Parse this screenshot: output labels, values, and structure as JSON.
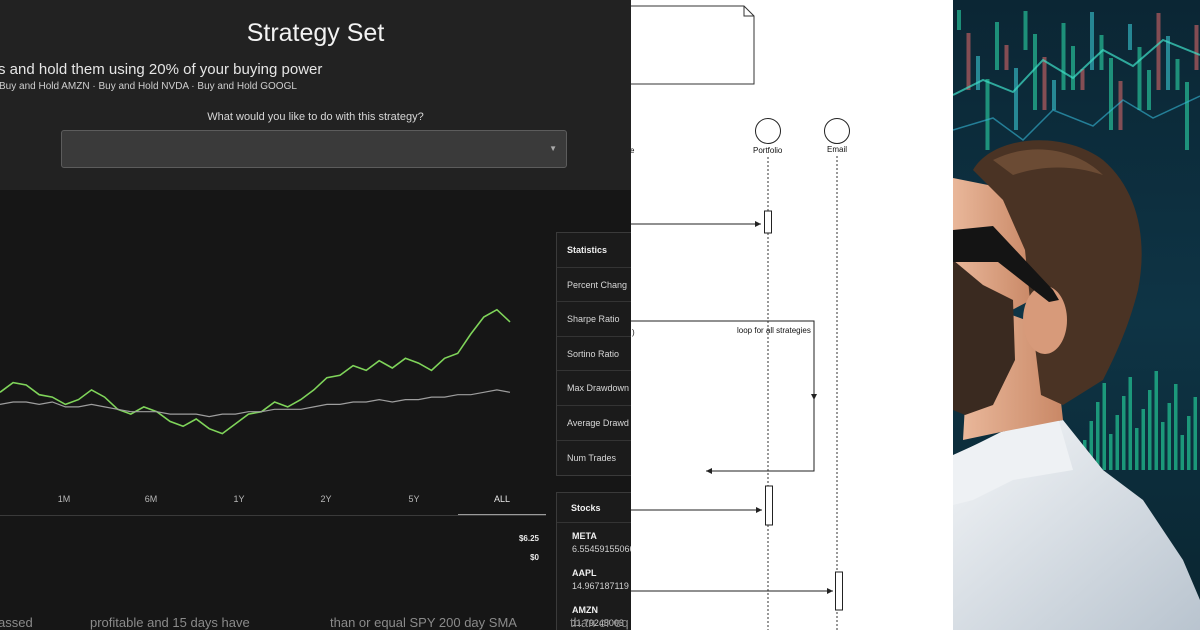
{
  "strategy": {
    "title": "Strategy Set",
    "subtitle": "s and hold them using 20% of your buying power",
    "components": "Buy and Hold AMZN · Buy and Hold NVDA · Buy and Hold GOOGL",
    "question": "What would you like to do with this strategy?",
    "select": {
      "selected": "",
      "arrow_icon": "caret-down-icon"
    }
  },
  "chart": {
    "range_tabs": [
      "1M",
      "6M",
      "1Y",
      "2Y",
      "5Y",
      "ALL"
    ],
    "active_tab": "ALL",
    "price_labels": [
      "$6.25",
      "$0"
    ],
    "colors": {
      "strategy": "#7fd45a",
      "benchmark": "#9e9e9e",
      "background": "#161616"
    }
  },
  "chart_data": {
    "type": "line",
    "x_labels": [
      "1M",
      "6M",
      "1Y",
      "2Y",
      "5Y",
      "ALL"
    ],
    "series": [
      {
        "color": "#7fd45a",
        "values": [
          3.2,
          3.6,
          3.5,
          3.1,
          3.0,
          2.7,
          2.9,
          3.3,
          3.0,
          2.5,
          2.3,
          2.6,
          2.4,
          2.0,
          1.8,
          2.1,
          1.7,
          1.5,
          1.9,
          2.3,
          2.4,
          2.8,
          2.6,
          2.9,
          3.3,
          3.8,
          3.9,
          4.3,
          4.1,
          4.5,
          4.2,
          4.6,
          4.4,
          4.1,
          4.6,
          4.8,
          5.6,
          6.3,
          6.6,
          6.1
        ]
      },
      {
        "color": "#9e9e9e",
        "values": [
          2.7,
          2.8,
          2.8,
          2.7,
          2.8,
          2.6,
          2.6,
          2.7,
          2.6,
          2.5,
          2.4,
          2.4,
          2.4,
          2.3,
          2.3,
          2.3,
          2.2,
          2.3,
          2.3,
          2.4,
          2.4,
          2.5,
          2.5,
          2.5,
          2.6,
          2.7,
          2.7,
          2.8,
          2.8,
          2.9,
          2.8,
          2.9,
          2.9,
          3.0,
          3.0,
          3.1,
          3.1,
          3.2,
          3.3,
          3.2
        ]
      }
    ]
  },
  "statistics": {
    "header": "Statistics",
    "rows": [
      "Percent Chang",
      "Sharpe Ratio",
      "Sortino Ratio",
      "Max Drawdown",
      "Average Drawd",
      "Num Trades"
    ]
  },
  "stocks": {
    "header": "Stocks",
    "items": [
      {
        "symbol": "META",
        "value": "6.55459155066"
      },
      {
        "symbol": "AAPL",
        "value": "14.967187119"
      },
      {
        "symbol": "AMZN",
        "value": "11.79245003"
      }
    ]
  },
  "bottom_text": [
    "assed",
    "profitable and 15 days have",
    "than or equal SPY 200 day SMA",
    "than or eq"
  ],
  "diagram": {
    "participants": [
      "Portfolio",
      "Email"
    ],
    "partial_label": "e",
    "loop_label": "loop for all strategies",
    "loop_edge_label": ")"
  }
}
